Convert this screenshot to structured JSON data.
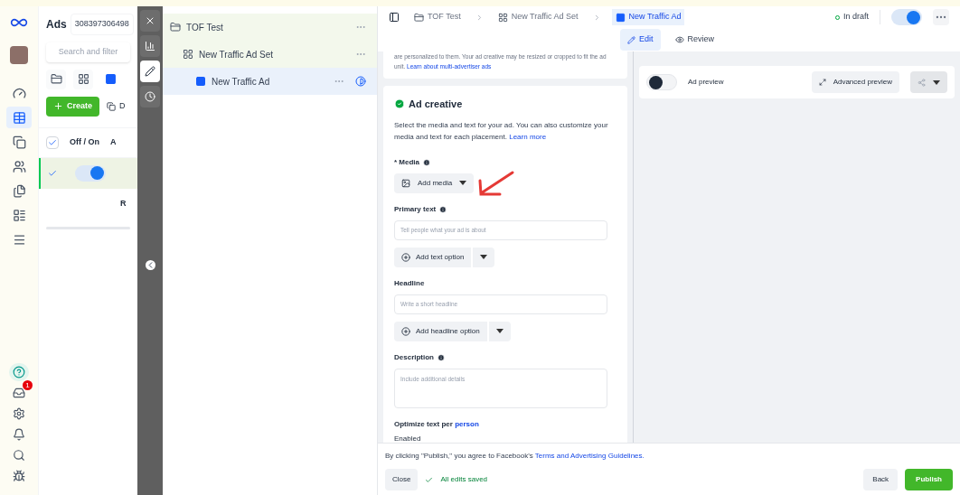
{
  "nav_rail": {
    "items": [
      {
        "kind": "gauge",
        "selected": false
      },
      {
        "kind": "table",
        "selected": true
      },
      {
        "kind": "pages",
        "selected": false
      },
      {
        "kind": "people",
        "selected": false
      },
      {
        "kind": "files",
        "selected": false
      },
      {
        "kind": "list",
        "selected": false
      },
      {
        "kind": "menu",
        "selected": false
      }
    ],
    "bottom_items": [
      {
        "kind": "help"
      },
      {
        "kind": "inbox",
        "badge": "1"
      },
      {
        "kind": "settings"
      },
      {
        "kind": "bell"
      },
      {
        "kind": "search"
      },
      {
        "kind": "bug"
      }
    ]
  },
  "left_panel": {
    "title": "Ads",
    "account_id": "308397306498",
    "search": {
      "placeholder": "Search and filter"
    },
    "view_tabs": [
      {
        "kind": "campaign",
        "selected": false
      },
      {
        "kind": "adset",
        "selected": false
      },
      {
        "kind": "ad",
        "selected": true
      }
    ],
    "create_button": "Create",
    "second_button": "D",
    "table": {
      "header_checked": true,
      "columns": [
        "Off / On",
        "A"
      ],
      "rows": [
        {
          "checked": true,
          "on": true,
          "column_2": ""
        },
        {
          "checked": false,
          "on": false,
          "column_2": "R"
        }
      ]
    }
  },
  "side_toolbar": [
    {
      "kind": "close",
      "selected": false
    },
    {
      "kind": "chart",
      "selected": false
    },
    {
      "kind": "edit",
      "selected": true
    },
    {
      "kind": "history",
      "selected": false
    }
  ],
  "tree": [
    {
      "label": "TOF Test",
      "kind": "campaign",
      "selected": false,
      "children": [
        {
          "label": "New Traffic Ad Set",
          "kind": "adset",
          "selected": false,
          "children": [
            {
              "label": "New Traffic Ad",
              "kind": "ad",
              "selected": true
            }
          ]
        }
      ]
    }
  ],
  "breadcrumbs": [
    {
      "label": "TOF Test",
      "kind": "campaign",
      "selected": false
    },
    {
      "label": "New Traffic Ad Set",
      "kind": "adset",
      "selected": false
    },
    {
      "label": "New Traffic Ad",
      "kind": "ad",
      "selected": true
    }
  ],
  "status": "In draft",
  "ad_on": true,
  "mode_tabs": [
    {
      "label": "Edit",
      "kind": "edit",
      "selected": true
    },
    {
      "label": "Review",
      "kind": "review",
      "selected": false
    }
  ],
  "editor": {
    "intro_text": "are personalized to them. Your ad creative may be resized or cropped to fit the ad unit.",
    "intro_link": "Learn about multi-advertiser ads",
    "section_title": "Ad creative",
    "section_complete": true,
    "section_text": "Select the media and text for your ad. You can also customize your media and text for each placement.",
    "section_link": "Learn more",
    "fields": [
      {
        "kind": "media",
        "label": "* Media",
        "info": true,
        "button": "Add media"
      },
      {
        "kind": "text",
        "label": "Primary text",
        "info": true,
        "placeholder": "Tell people what your ad is about",
        "option_button": "Add text option"
      },
      {
        "kind": "text",
        "label": "Headline",
        "placeholder": "Write a short headline",
        "option_button": "Add headline option"
      },
      {
        "kind": "textarea",
        "label": "Description",
        "info": true,
        "placeholder": "Include additional details"
      }
    ],
    "optimize_label": "Optimize text per",
    "optimize_link": "person",
    "optimize_value": "Enabled"
  },
  "preview": {
    "toggle_label": "Ad preview",
    "toggle_on": false,
    "advanced_button": "Advanced preview"
  },
  "footer": {
    "notice": "By clicking \"Publish,\" you agree to Facebook's",
    "notice_link": "Terms and Advertising Guidelines.",
    "close": "Close",
    "saved": "All edits saved",
    "back": "Back",
    "publish": "Publish"
  }
}
